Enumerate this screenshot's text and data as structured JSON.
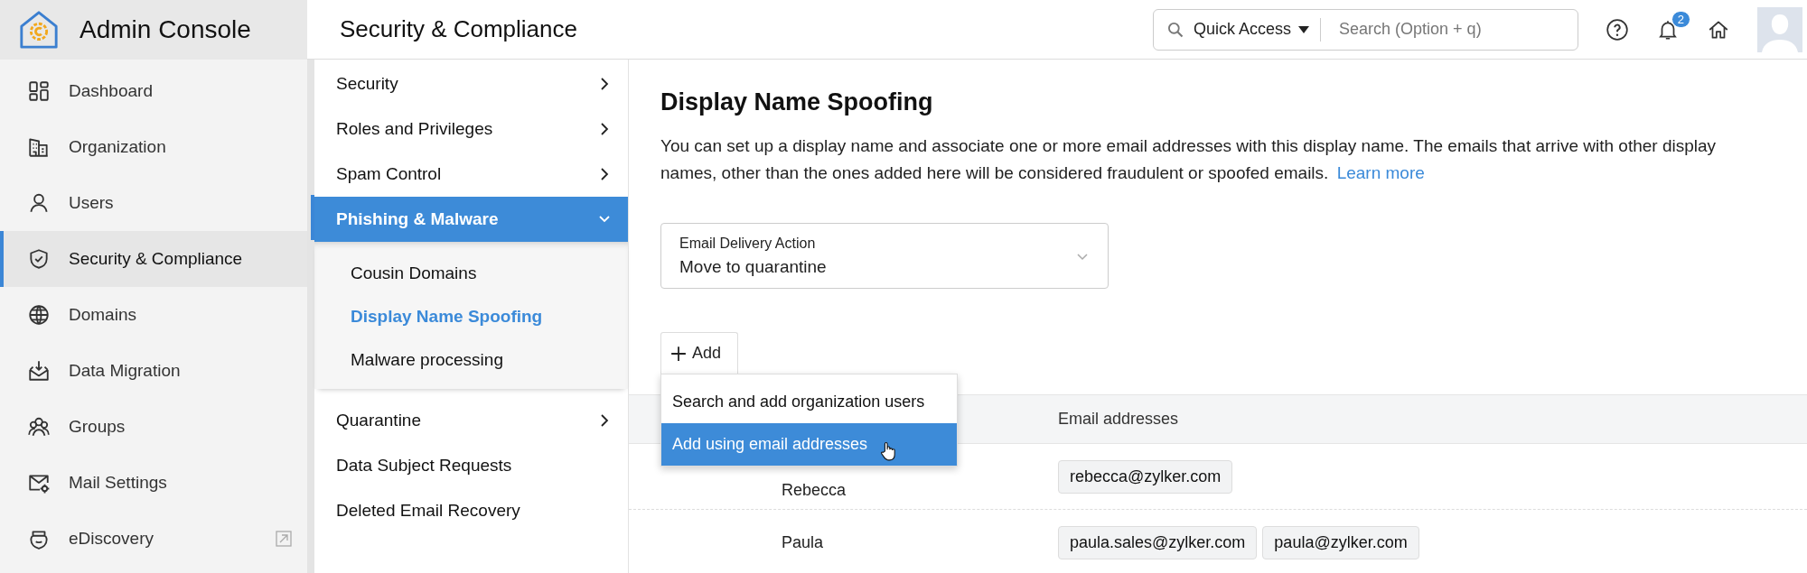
{
  "app": {
    "title": "Admin Console"
  },
  "sidebar": {
    "items": [
      {
        "label": "Dashboard",
        "selected": false,
        "external": false
      },
      {
        "label": "Organization",
        "selected": false,
        "external": false
      },
      {
        "label": "Users",
        "selected": false,
        "external": false
      },
      {
        "label": "Security & Compliance",
        "selected": true,
        "external": false
      },
      {
        "label": "Domains",
        "selected": false,
        "external": false
      },
      {
        "label": "Data Migration",
        "selected": false,
        "external": false
      },
      {
        "label": "Groups",
        "selected": false,
        "external": false
      },
      {
        "label": "Mail Settings",
        "selected": false,
        "external": false
      },
      {
        "label": "eDiscovery",
        "selected": false,
        "external": true
      }
    ]
  },
  "page_title": "Security & Compliance",
  "header": {
    "quick_access": "Quick Access",
    "search": {
      "placeholder": "Search (Option + q)"
    },
    "notifications_badge": "2"
  },
  "subnav": {
    "items": [
      {
        "label": "Security",
        "selected": false,
        "expandable": true,
        "expanded": false
      },
      {
        "label": "Roles and Privileges",
        "selected": false,
        "expandable": true,
        "expanded": false
      },
      {
        "label": "Spam Control",
        "selected": false,
        "expandable": true,
        "expanded": false
      },
      {
        "label": "Phishing & Malware",
        "selected": true,
        "expandable": true,
        "expanded": true,
        "children": [
          {
            "label": "Cousin Domains",
            "selected": false
          },
          {
            "label": "Display Name Spoofing",
            "selected": true
          },
          {
            "label": "Malware processing",
            "selected": false
          }
        ]
      },
      {
        "label": "Quarantine",
        "selected": false,
        "expandable": true,
        "expanded": false
      },
      {
        "label": "Data Subject Requests",
        "selected": false,
        "expandable": false
      },
      {
        "label": "Deleted Email Recovery",
        "selected": false,
        "expandable": false
      }
    ]
  },
  "content": {
    "title": "Display Name Spoofing",
    "description": "You can set up a display name and associate one or more email addresses with this display name. The emails that arrive with other display names, other than the ones added here will be considered fraudulent or spoofed emails.",
    "link": "Learn more",
    "delivery_action": {
      "label": "Email Delivery Action",
      "value": "Move to quarantine"
    },
    "add_button": "Add",
    "add_menu": [
      {
        "label": "Search and add organization users",
        "selected": false
      },
      {
        "label": "Add using email addresses",
        "selected": true
      }
    ],
    "table": {
      "columns": [
        "Email addresses"
      ],
      "rows": [
        {
          "name": "Rebecca",
          "emails": [
            "rebecca@zylker.com"
          ]
        },
        {
          "name": "Paula",
          "emails": [
            "paula.sales@zylker.com",
            "paula@zylker.com"
          ]
        }
      ]
    }
  }
}
